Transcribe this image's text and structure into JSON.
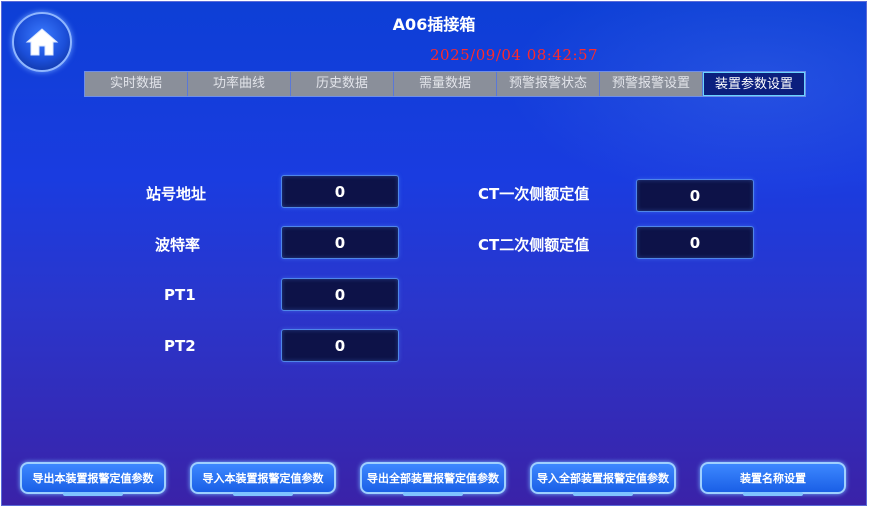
{
  "header": {
    "title": "A06插接箱",
    "datetime": "2025/09/04 08:42:57"
  },
  "tabs": [
    {
      "label": "实时数据"
    },
    {
      "label": "功率曲线"
    },
    {
      "label": "历史数据"
    },
    {
      "label": "需量数据"
    },
    {
      "label": "预警报警状态"
    },
    {
      "label": "预警报警设置"
    },
    {
      "label": "装置参数设置"
    }
  ],
  "params": {
    "station_address": {
      "label": "站号地址",
      "value": "0"
    },
    "baud_rate": {
      "label": "波特率",
      "value": "0"
    },
    "pt1": {
      "label": "PT1",
      "value": "0"
    },
    "pt2": {
      "label": "PT2",
      "value": "0"
    },
    "ct_primary": {
      "label": "CT一次侧额定值",
      "value": "0"
    },
    "ct_secondary": {
      "label": "CT二次侧额定值",
      "value": "0"
    }
  },
  "buttons": {
    "export_this": "导出本装置报警定值参数",
    "import_this": "导入本装置报警定值参数",
    "export_all": "导出全部装置报警定值参数",
    "import_all": "导入全部装置报警定值参数",
    "name_setting": "装置名称设置"
  },
  "colors": {
    "datetime": "#ff2a2a",
    "active_tab": "#0b1f7e",
    "inactive_tab": "#8a8f9a"
  }
}
